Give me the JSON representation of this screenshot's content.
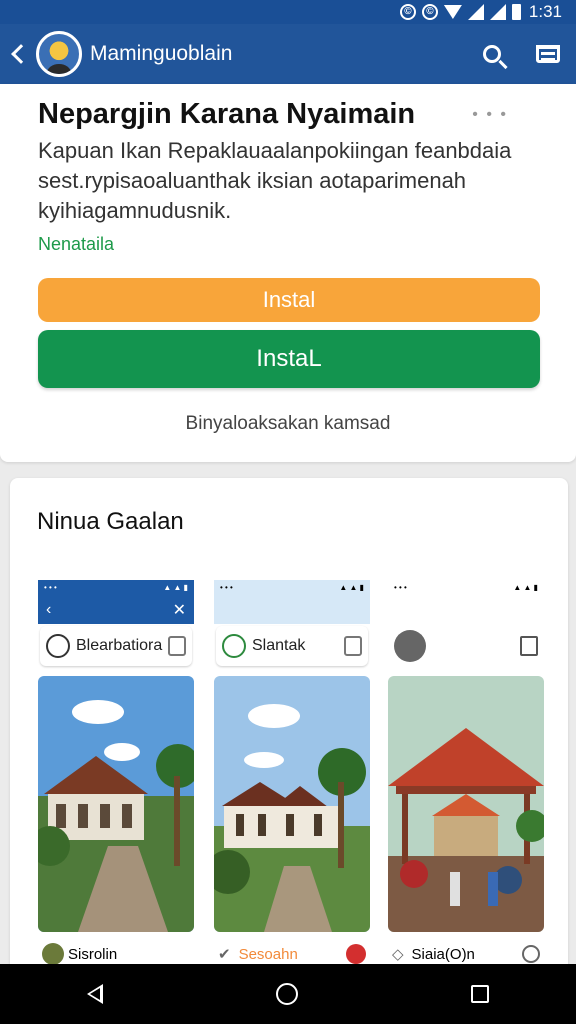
{
  "status_bar": {
    "time": "1:31",
    "icon1": "©",
    "icon2": "©"
  },
  "app_bar": {
    "title": "Maminguoblain",
    "back_icon": "chevron-left-icon",
    "search_icon": "search-icon",
    "cart_icon": "cart-icon"
  },
  "top_card": {
    "headline": "Nepargjin Karana Nyaimain",
    "description": "Kapuan Ikan Repaklauaalanpokiingan feanbdaia sest.rypisaoaluanthak iksian aotaparimenah kyihiagamnudusnik.",
    "rating_label": "Nenataila",
    "orange_button_label": "Instal",
    "green_button_label": "InstaL",
    "secondary_text": "Binyaloaksakan kamsad",
    "dots": "• • •"
  },
  "gallery": {
    "title": "Ninua Gaalan",
    "shots": [
      {
        "chip_label": "Blearbatiora",
        "bottom_label": "Sisrolin"
      },
      {
        "chip_label": "Slantak",
        "bottom_label": "Sesoahn"
      },
      {
        "chip_label": "",
        "bottom_label": "Siaia(O)n"
      }
    ]
  },
  "colors": {
    "app_bar": "#21559a",
    "status_bar": "#1a4f96",
    "orange": "#f8a53a",
    "green": "#13944f",
    "rating_green": "#1e9a4a"
  }
}
